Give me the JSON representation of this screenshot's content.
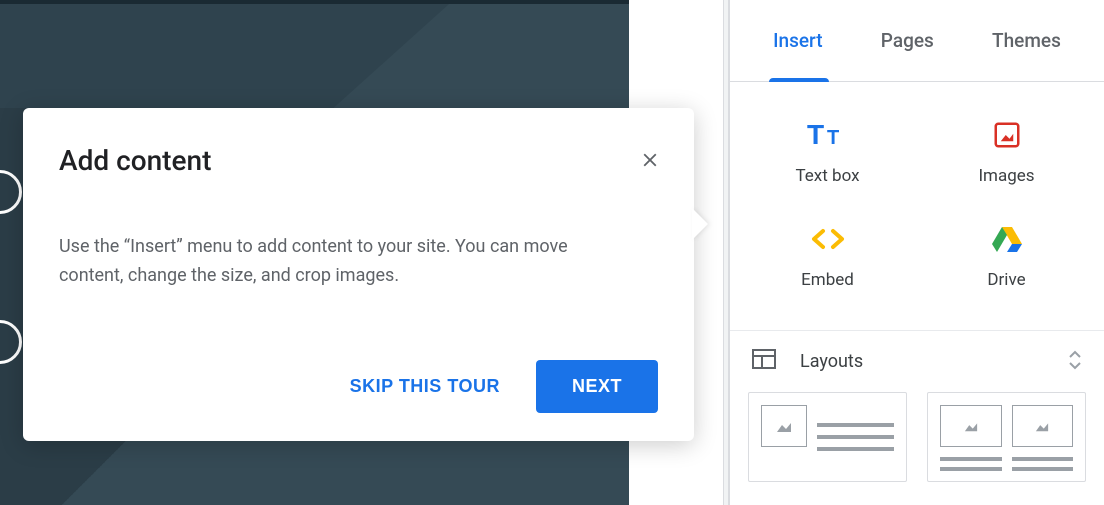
{
  "tour": {
    "title": "Add content",
    "body": "Use the “Insert” menu to add content to your site. You can move content, change the size, and crop images.",
    "skip_label": "SKIP THIS TOUR",
    "next_label": "NEXT"
  },
  "panel": {
    "tabs": {
      "insert": "Insert",
      "pages": "Pages",
      "themes": "Themes"
    },
    "insert_items": {
      "textbox": "Text box",
      "images": "Images",
      "embed": "Embed",
      "drive": "Drive"
    },
    "layouts_label": "Layouts"
  }
}
